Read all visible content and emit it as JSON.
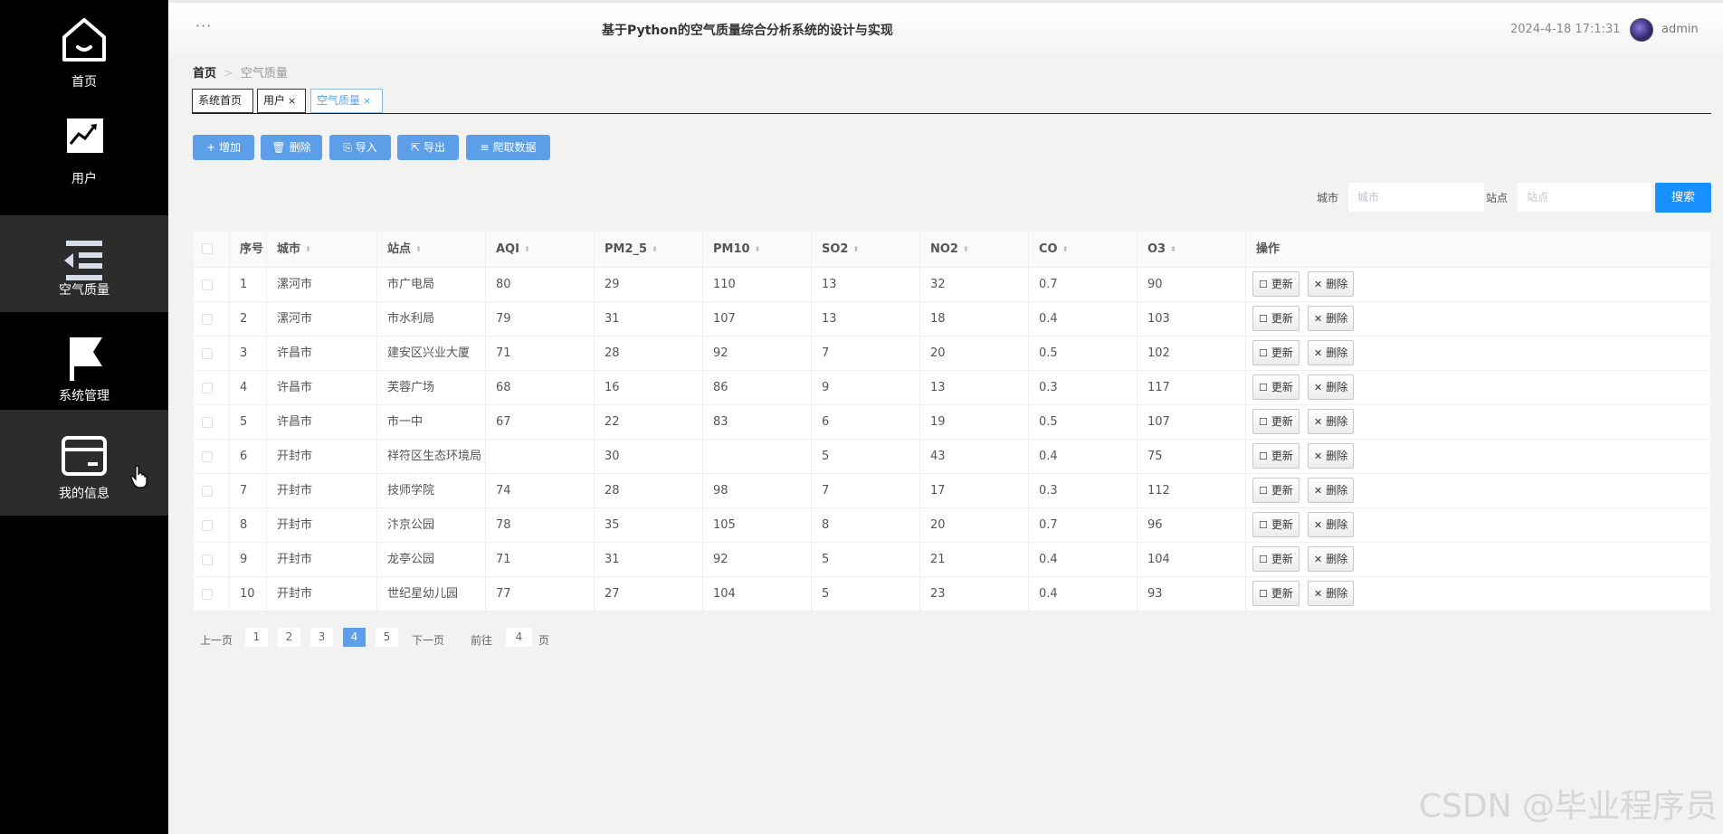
{
  "sidebar": {
    "items": [
      {
        "label": "首页",
        "icon": "home-icon"
      },
      {
        "label": "用户",
        "icon": "chart-icon"
      },
      {
        "label": "空气质量",
        "icon": "list-indent-icon"
      },
      {
        "label": "系统管理",
        "icon": "flag-icon"
      },
      {
        "label": "我的信息",
        "icon": "card-icon"
      }
    ]
  },
  "header": {
    "menu_dots": "···",
    "title": "基于Python的空气质量综合分析系统的设计与实现",
    "datetime": "2024-4-18 17:1:31",
    "username": "admin"
  },
  "breadcrumb": {
    "home": "首页",
    "separator": ">",
    "current": "空气质量"
  },
  "tabs": [
    {
      "label": "系统首页",
      "closable": false
    },
    {
      "label": "用户",
      "closable": true
    },
    {
      "label": "空气质量",
      "closable": true
    }
  ],
  "tab_close": "×",
  "toolbar": {
    "add": "增加",
    "delete": "删除",
    "import": "导入",
    "export": "导出",
    "crawl": "爬取数据"
  },
  "search": {
    "city_label": "城市",
    "city_placeholder": "城市",
    "station_label": "站点",
    "station_placeholder": "站点",
    "button": "搜索"
  },
  "table": {
    "columns": [
      "序号",
      "城市",
      "站点",
      "AQI",
      "PM2_5",
      "PM10",
      "SO2",
      "NO2",
      "CO",
      "O3",
      "操作"
    ],
    "sort_glyph": "⬍",
    "update_label": "更新",
    "delete_label": "删除",
    "rows": [
      [
        "1",
        "漯河市",
        "市广电局",
        "80",
        "29",
        "110",
        "13",
        "32",
        "0.7",
        "90"
      ],
      [
        "2",
        "漯河市",
        "市水利局",
        "79",
        "31",
        "107",
        "13",
        "18",
        "0.4",
        "103"
      ],
      [
        "3",
        "许昌市",
        "建安区兴业大厦",
        "71",
        "28",
        "92",
        "7",
        "20",
        "0.5",
        "102"
      ],
      [
        "4",
        "许昌市",
        "芙蓉广场",
        "68",
        "16",
        "86",
        "9",
        "13",
        "0.3",
        "117"
      ],
      [
        "5",
        "许昌市",
        "市一中",
        "67",
        "22",
        "83",
        "6",
        "19",
        "0.5",
        "107"
      ],
      [
        "6",
        "开封市",
        "祥符区生态环境局",
        "",
        "30",
        "",
        "5",
        "43",
        "0.4",
        "75"
      ],
      [
        "7",
        "开封市",
        "技师学院",
        "74",
        "28",
        "98",
        "7",
        "17",
        "0.3",
        "112"
      ],
      [
        "8",
        "开封市",
        "汴京公园",
        "78",
        "35",
        "105",
        "8",
        "20",
        "0.7",
        "96"
      ],
      [
        "9",
        "开封市",
        "龙亭公园",
        "71",
        "31",
        "92",
        "5",
        "21",
        "0.4",
        "104"
      ],
      [
        "10",
        "开封市",
        "世纪星幼儿园",
        "77",
        "27",
        "104",
        "5",
        "23",
        "0.4",
        "93"
      ]
    ]
  },
  "pagination": {
    "prev": "上一页",
    "pages": [
      "1",
      "2",
      "3",
      "4",
      "5"
    ],
    "current": "4",
    "next": "下一页",
    "goto_label": "前往",
    "goto_value": "4",
    "page_suffix": "页"
  },
  "watermark": "CSDN @毕业程序员"
}
